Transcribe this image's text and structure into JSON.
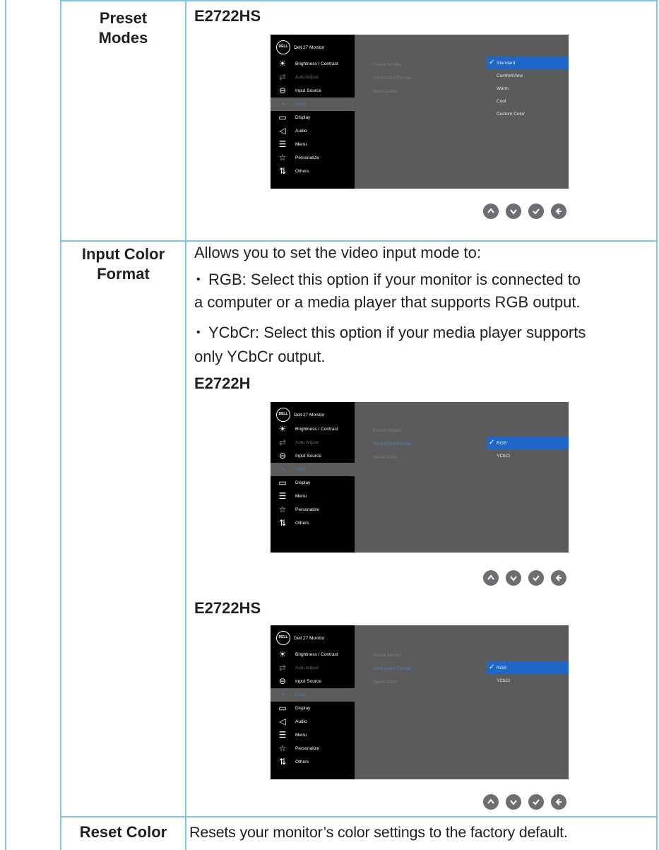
{
  "rows": {
    "preset_modes": {
      "label_line1": "Preset",
      "label_line2": "Modes",
      "model": "E2722HS"
    },
    "input_color_format": {
      "label_line1": "Input Color",
      "label_line2": "Format",
      "intro": "Allows you to set the video input mode to:",
      "bullet_rgb_term": "RGB:",
      "bullet_rgb_line1": " Select this option if your monitor is connected to",
      "bullet_rgb_line2": "a computer or a media player that supports RGB output.",
      "bullet_ycbcr_term": "YCbCr:",
      "bullet_ycbcr_line1": " Select this option if your media player supports",
      "bullet_ycbcr_line2": "only YCbCr output.",
      "model_a": "E2722H",
      "model_b": "E2722HS"
    },
    "reset_color": {
      "label": "Reset Color",
      "text": "Resets your monitor’s color settings to the factory default."
    }
  },
  "osd": {
    "logo": "DELL",
    "title": "Dell 27 Monitor",
    "menu": {
      "brightness": "Brightness / Contrast",
      "auto_adjust": "Auto Adjust",
      "input_source": "Input Source",
      "color": "Color",
      "display": "Display",
      "audio": "Audio",
      "menu": "Menu",
      "personalize": "Personalize",
      "others": "Others"
    },
    "sub": {
      "preset_modes": "Preset Modes",
      "input_color_format": "Input Color Format",
      "reset_color": "Reset Color"
    },
    "preset_options": [
      "Standard",
      "ComfortView",
      "Warm",
      "Cool",
      "Custom Color"
    ],
    "format_options": [
      "RGB",
      "YCbCr"
    ],
    "check": "✓"
  },
  "colors": {
    "border": "#7fc4ea",
    "osd_bg": "#5b5b5b",
    "highlight": "#1e66c8"
  }
}
